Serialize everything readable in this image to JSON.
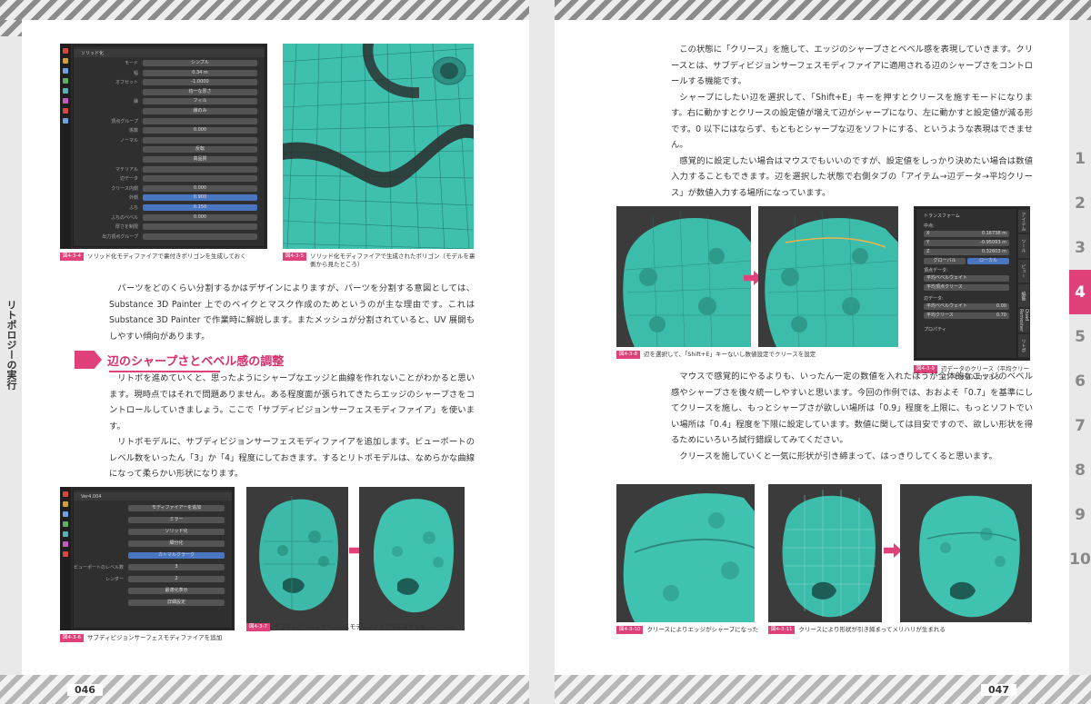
{
  "left_page": {
    "number": "046",
    "side_title": "リトポロジーの実行",
    "solidify_panel": {
      "header": "ソリッド化",
      "rows": [
        {
          "label": "モード",
          "value": "シンプル"
        },
        {
          "label": "幅",
          "value": "0.34 m"
        },
        {
          "label": "オフセット",
          "value": "-1.0000"
        },
        {
          "label": "",
          "value": "均一な厚さ"
        },
        {
          "label": "縁",
          "value": "フィル"
        },
        {
          "label": "",
          "value": "縁のみ"
        },
        {
          "label": "頂点グループ",
          "value": ""
        },
        {
          "label": "係数",
          "value": "0.000"
        },
        {
          "label": "ノーマル",
          "value": ""
        },
        {
          "label": "",
          "value": "反転"
        },
        {
          "label": "",
          "value": "高品質"
        },
        {
          "label": "マテリアル",
          "value": ""
        },
        {
          "label": "辺データ",
          "value": ""
        },
        {
          "label": "クリース内側",
          "value": "0.000"
        },
        {
          "label": "外側",
          "value": "0.900"
        },
        {
          "label": "ふち",
          "value": "0.150"
        },
        {
          "label": "ふちのベベル",
          "value": "0.000"
        },
        {
          "label": "厚さを制限",
          "value": ""
        },
        {
          "label": "出力頂点グループ",
          "value": ""
        }
      ]
    },
    "fig_4_3_4": {
      "badge": "図4-3-4",
      "caption": "ソリッド化モディファイアで裏付きポリゴンを生成しておく"
    },
    "fig_4_3_5": {
      "badge": "図4-3-5",
      "caption": "ソリッド化モディファイアで生成されたポリゴン（モデルを裏側から見たところ）"
    },
    "paragraph_1": "パーツをどのくらい分割するかはデザインによりますが、パーツを分割する意図としては、Substance 3D Painter 上でのベイクとマスク作成のためというのが主な理由です。これはSubstance 3D Painter で作業時に解説します。またメッシュが分割されていると、UV 展開もしやすい傾向があります。",
    "heading": "辺のシャープさとベベル感の調整",
    "paragraph_2": "リトポを進めていくと、思ったようにシャープなエッジと曲線を作れないことがわかると思います。現時点ではそれで問題ありません。ある程度面が張られてきたらエッジのシャープさをコントロールしていきましょう。ここで「サブディビジョンサーフェスモディファイア」を使います。",
    "paragraph_3": "リトポモデルに、サブディビジョンサーフェスモディファイアを追加します。ビューポートのレベル数をいったん「3」か「4」程度にしておきます。するとリトポモデルは、なめらかな曲線になって柔らかい形状になります。",
    "subsurf_panel": {
      "header": "Ver4.004",
      "rows": [
        {
          "label": "",
          "value": "モディファイアーを追加"
        },
        {
          "label": "",
          "value": "ミラー"
        },
        {
          "label": "",
          "value": "ソリッド化"
        },
        {
          "label": "",
          "value": "細分化"
        },
        {
          "label": "",
          "value": "カトマルクラーク"
        },
        {
          "label": "ビューポートのレベル数",
          "value": "3"
        },
        {
          "label": "レンダー",
          "value": "2"
        },
        {
          "label": "",
          "value": "最適化表示"
        },
        {
          "label": "",
          "value": "詳細設定"
        }
      ]
    },
    "fig_4_3_6": {
      "badge": "図4-3-6",
      "caption": "サブディビジョンサーフェスモディファイアを追加"
    },
    "fig_4_3_7": {
      "badge": "図4-3-7",
      "caption": "サブディビジョンサーフェスモディファイアで形状がなめらかになる"
    }
  },
  "right_page": {
    "number": "047",
    "paragraph_1": "この状態に「クリース」を施して、エッジのシャープさとベベル感を表現していきます。クリースとは、サブディビジョンサーフェスモディファイアに適用される辺のシャープさをコントロールする機能です。",
    "paragraph_2": "シャープにしたい辺を選択して、「Shift+E」キーを押すとクリースを施すモードになります。右に動かすとクリースの設定値が増えて辺がシャープになり、左に動かすと設定値が減る形です。0 以下にはならず、もともとシャープな辺をソフトにする、というような表現はできません。",
    "paragraph_3": "感覚的に設定したい場合はマウスでもいいのですが、設定値をしっかり決めたい場合は数値入力することもできます。辺を選択した状態で右側タブの「アイテム→辺データ→平均クリース」が数値入力する場所になっています。",
    "transform_panel": {
      "header": "トランスフォーム",
      "median": "中点:",
      "rows": [
        {
          "label": "X",
          "value": "0.16738 m"
        },
        {
          "label": "Y",
          "value": "-0.95093 m"
        },
        {
          "label": "Z",
          "value": "0.32603 m"
        }
      ],
      "global": "グローバル",
      "local": "ローカル",
      "vertex_data": "頂点データ:",
      "vertex_bevel": "平均ベベルウェイト",
      "vertex_crease": "平均頂点クリース",
      "edge_data": "辺データ:",
      "edge_bevel": "平均ベベルウェイト",
      "edge_crease": "平均クリース",
      "edge_bevel_val": "0.00",
      "edge_crease_val": "0.70",
      "properties": "プロパティ",
      "tabs": [
        "アイテム",
        "ツール",
        "ビュー",
        "編集",
        "Quad Remesher",
        "リトポ"
      ]
    },
    "fig_4_3_8": {
      "badge": "図4-3-8",
      "caption": "辺を選択して、「Shift+E」キーないし数値設定でクリースを設定"
    },
    "fig_4_3_9": {
      "badge": "図4-3-9",
      "caption": "辺データのクリース（平均クリース）で数値入力できる"
    },
    "paragraph_4": "マウスで感覚的にやるよりも、いったん一定の数値を入れたほうが全体的なエッジのベベル感やシャープさを後々統一しやすいと思います。今回の作例では、おおよそ「0.7」を基準にしてクリースを施し、もっとシャープさが欲しい場所は「0.9」程度を上限に、もっとソフトでいい場所は「0.4」程度を下限に設定しています。数値に関しては目安ですので、欲しい形状を得るためにいろいろ試行錯誤してみてください。",
    "paragraph_5": "クリースを施していくと一気に形状が引き締まって、はっきりしてくると思います。",
    "fig_4_3_10": {
      "badge": "図4-3-10",
      "caption": "クリースによりエッジがシャープになった"
    },
    "fig_4_3_11": {
      "badge": "図4-3-11",
      "caption": "クリースにより形状が引き締まってメリハリが生まれる"
    }
  },
  "chapters": [
    "1",
    "2",
    "3",
    "4",
    "5",
    "6",
    "7",
    "8",
    "9",
    "10"
  ],
  "active_chapter": "4",
  "colors": {
    "accent": "#e0417a",
    "teal": "#3cc1b0",
    "panel_bg": "#2f2f2f",
    "field_blue": "#4a75c0"
  }
}
